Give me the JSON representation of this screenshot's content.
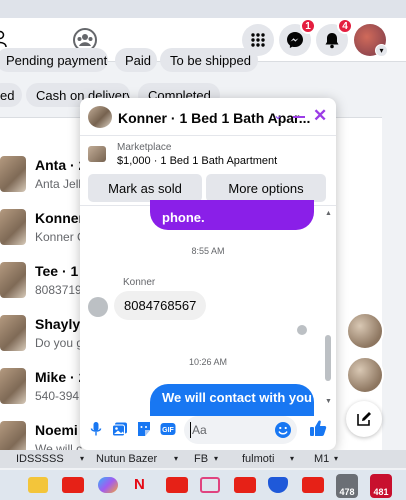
{
  "header": {
    "messenger_badge": "1",
    "notifications_badge": "4"
  },
  "filters": {
    "row1": [
      "Pending payment",
      "Paid",
      "To be shipped"
    ],
    "row2": [
      "ed",
      "Cash on delivery",
      "Completed"
    ]
  },
  "list": [
    {
      "name": "Anta · 2",
      "sub": "Anta Jello"
    },
    {
      "name": "Konner",
      "sub": "Konner C"
    },
    {
      "name": "Tee · 1 E",
      "sub": "8083719"
    },
    {
      "name": "Shaylyn",
      "sub": "Do you g"
    },
    {
      "name": "Mike · 2",
      "sub": "540-394"
    },
    {
      "name": "Noemi",
      "sub": "We will c"
    }
  ],
  "chat": {
    "title": "Konner · 1 Bed 1 Bath Apar...",
    "marketplace_label": "Marketplace",
    "listing": "$1,000 · 1 Bed 1 Bath Apartment",
    "mark_sold": "Mark as sold",
    "more_options": "More options",
    "messages": {
      "out_partial": "phone.",
      "time1": "8:55 AM",
      "sender": "Konner",
      "in1": "8084768567",
      "time2": "10:26 AM",
      "out2": "We will contact with you"
    },
    "composer_placeholder": "Aa"
  },
  "bookmarks": [
    "IDSSSSS",
    "Nutun Bazer",
    "FB",
    "fulmoti",
    "M1"
  ],
  "taskbar": {
    "badge1": "478",
    "badge2": "481"
  },
  "colors": {
    "messenger_purple": "#8a1fe8",
    "facebook_blue": "#1877f2",
    "badge_red": "#e41e3f"
  }
}
